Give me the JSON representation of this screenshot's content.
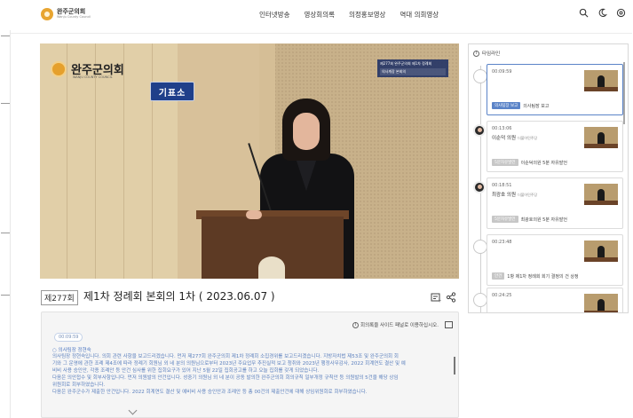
{
  "header": {
    "logo_text": "완주군의회",
    "logo_sub": "Wanju County Council",
    "nav": [
      "인터넷방송",
      "영상회의록",
      "의정홍보영상",
      "역대 의회영상"
    ],
    "icons": [
      "search-icon",
      "dark-mode-icon",
      "settings-icon"
    ]
  },
  "video": {
    "council_name": "완주군의회",
    "council_sub": "WANJU COUNTY COUNCIL",
    "reporter_sign": "기표소",
    "caption_line1": "제277회 완주군의회 제1차 정례회",
    "caption_line2": "의사계장 본회의"
  },
  "session": {
    "badge": "제277회",
    "title": "제1차 정례회 본회의 1차 ( 2023.06.07 )"
  },
  "transcript": {
    "note": "회의록을 사이드 패널로 이용하십시오.",
    "time": "00:09:59",
    "speaker": "○ 의사팀장 정현숙",
    "lines": [
      "의사팀장 정현숙입니다. 의회 관련 사항을 보고드리겠습니다. 먼저 제277회 완주군의회 제1차 정례회 소집경위를 보고드리겠습니다. 지방자치법 제53조 및 완주군의회 회",
      "기와 그 운영에 관한 조례 제4조에 따라 정례기 회원님 외 네 분의 의원님으로부터 2023년 주요업무 추진실적 보고 청취와 2023년 행정사무감사, 2022 회계연도 결산 및 예",
      "비비 사용 승인안, 각종 조례안 등 안건 심사를 위한 집회요구가 있어 지난 5월 22일 집회공고를 하고 오늘 집회를 갖게 되었습니다.",
      "다음은 의안접수 및 회부사항입니다. 먼저 의원발의 안건입니다. 성중기 의원님 외 네 분이 공동 발의한 완주군의회 회의규칙 일부개정 규칙안 등 의원발의 5건을 해당 상임",
      "위원회로 회부하였습니다.",
      "다음은 완주군수가 제출한 안건입니다. 2022 회계연도 결산 및 예비비 사용 승인안과 조례안 등 총 00건의 제출안건에 대해 상임위원회로 회부하였습니다."
    ]
  },
  "timeline": {
    "header": "타임라인",
    "items": [
      {
        "time": "00:09:59",
        "name": "",
        "party": "",
        "tag": "의사팀장 보고",
        "tag_label": "의사팀장 보고",
        "tag_color": "#5b84c8",
        "active": true,
        "avatar": false
      },
      {
        "time": "00:13:06",
        "name": "이순덕 의원",
        "party": "더불어민주당",
        "tag": "이순덕의원 5분 자유발언",
        "tag_label": "5분자유발언",
        "tag_color": "#c7c7c7",
        "active": false,
        "avatar": true
      },
      {
        "time": "00:18:51",
        "name": "최광호 의원",
        "party": "더불어민주당",
        "tag": "최광호의원 5분 자유발언",
        "tag_label": "5분자유발언",
        "tag_color": "#c7c7c7",
        "active": false,
        "avatar": true
      },
      {
        "time": "00:23:48",
        "name": "",
        "party": "",
        "tag": "1항 제1차 정례회 회기 결정의 건 상정",
        "tag_label": "안건",
        "tag_color": "#c7c7c7",
        "active": false,
        "avatar": false
      },
      {
        "time": "00:24:25",
        "name": "",
        "party": "",
        "tag": "",
        "tag_label": "",
        "tag_color": "#c7c7c7",
        "active": false,
        "avatar": false
      }
    ]
  }
}
